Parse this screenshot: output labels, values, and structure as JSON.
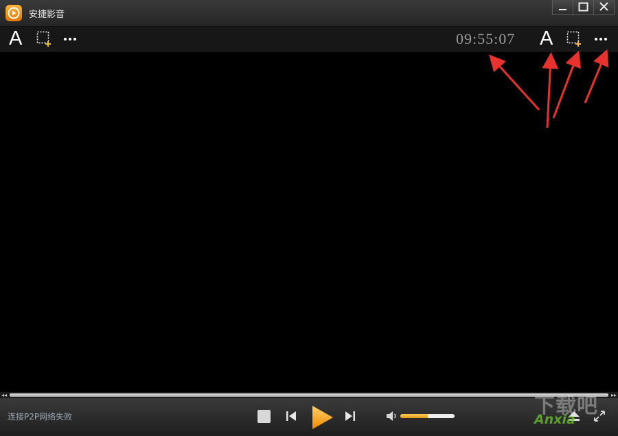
{
  "window": {
    "title": "安捷影音",
    "icon": "play-logo-icon",
    "controls": [
      "minimize-icon",
      "maximize-icon",
      "close-icon"
    ]
  },
  "toolbar": {
    "left": {
      "font_glyph": "A",
      "icons": [
        "font-icon",
        "screenshot-add-icon",
        "more-icon"
      ]
    },
    "right": {
      "clock": "09:55:07",
      "font_glyph": "A",
      "icons": [
        "font-icon",
        "screenshot-add-icon",
        "more-icon"
      ]
    }
  },
  "annotation": {
    "arrow_color": "#e8322d",
    "arrow_count": 4
  },
  "seekbar": {
    "progress": 0
  },
  "controlbar": {
    "status": "连接P2P网络失败",
    "icons": [
      "stop-icon",
      "previous-icon",
      "play-icon",
      "next-icon",
      "volume-icon",
      "eject-icon",
      "fullscreen-icon"
    ],
    "volume": 0.5,
    "accent": "#f4a52a"
  },
  "watermark": {
    "top": "下载吧",
    "bottom": "Anxia"
  }
}
